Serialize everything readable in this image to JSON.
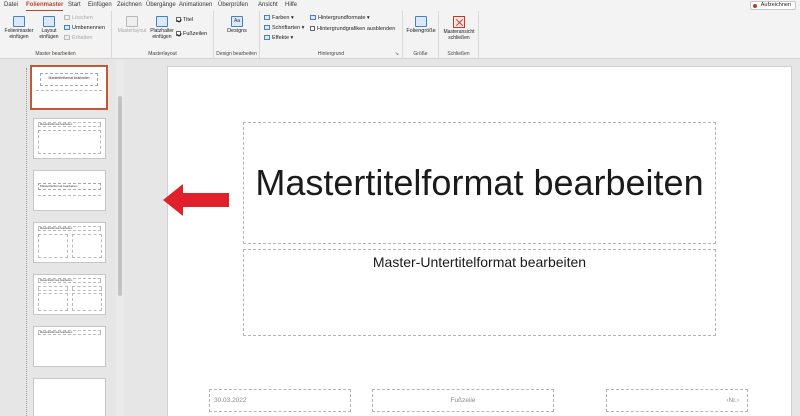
{
  "menu": {
    "tabs": [
      "Datei",
      "Folienmaster",
      "Start",
      "Einfügen",
      "Zeichnen",
      "Übergänge",
      "Animationen",
      "Überprüfen",
      "Ansicht",
      "Hilfe"
    ],
    "active_tab": "Folienmaster",
    "record_button": "Aufzeichnen"
  },
  "ribbon": {
    "master_edit": {
      "label": "Master bearbeiten",
      "insert_master": "Folienmaster einfügen",
      "insert_layout": "Layout einfügen",
      "delete": "Löschen",
      "rename": "Umbenennen",
      "preserve": "Erhalten"
    },
    "master_layout": {
      "label": "Masterlayout",
      "master_layout_btn": "Masterlayout",
      "insert_placeholder": "Platzhalter einfügen",
      "title_check": "Titel",
      "footer_check": "Fußzeilen"
    },
    "design_edit": {
      "label": "Design bearbeiten",
      "designs": "Designs"
    },
    "background": {
      "label": "Hintergrund",
      "colors": "Farben",
      "fonts": "Schriftarten",
      "effects": "Effekte",
      "bg_formats": "Hintergrundformate",
      "hide_bg_graphics": "Hintergrundgrafiken ausblenden"
    },
    "size": {
      "label": "Größe",
      "slide_size": "Foliengröße"
    },
    "close": {
      "label": "Schließen",
      "close_master": "Masteransicht schließen"
    }
  },
  "thumbnails": {
    "master_title": "Mastertitelformat bearbeiten",
    "layout_title": "Mastertitelformat bearbeiten"
  },
  "slide": {
    "title": "Mastertitelformat bearbeiten",
    "subtitle": "Master-Untertitelformat bearbeiten",
    "date": "30.03.2022",
    "footer": "Fußzeile",
    "slide_number": "‹Nr.›"
  },
  "colors": {
    "accent": "#b7472a",
    "arrow": "#e0202a"
  }
}
